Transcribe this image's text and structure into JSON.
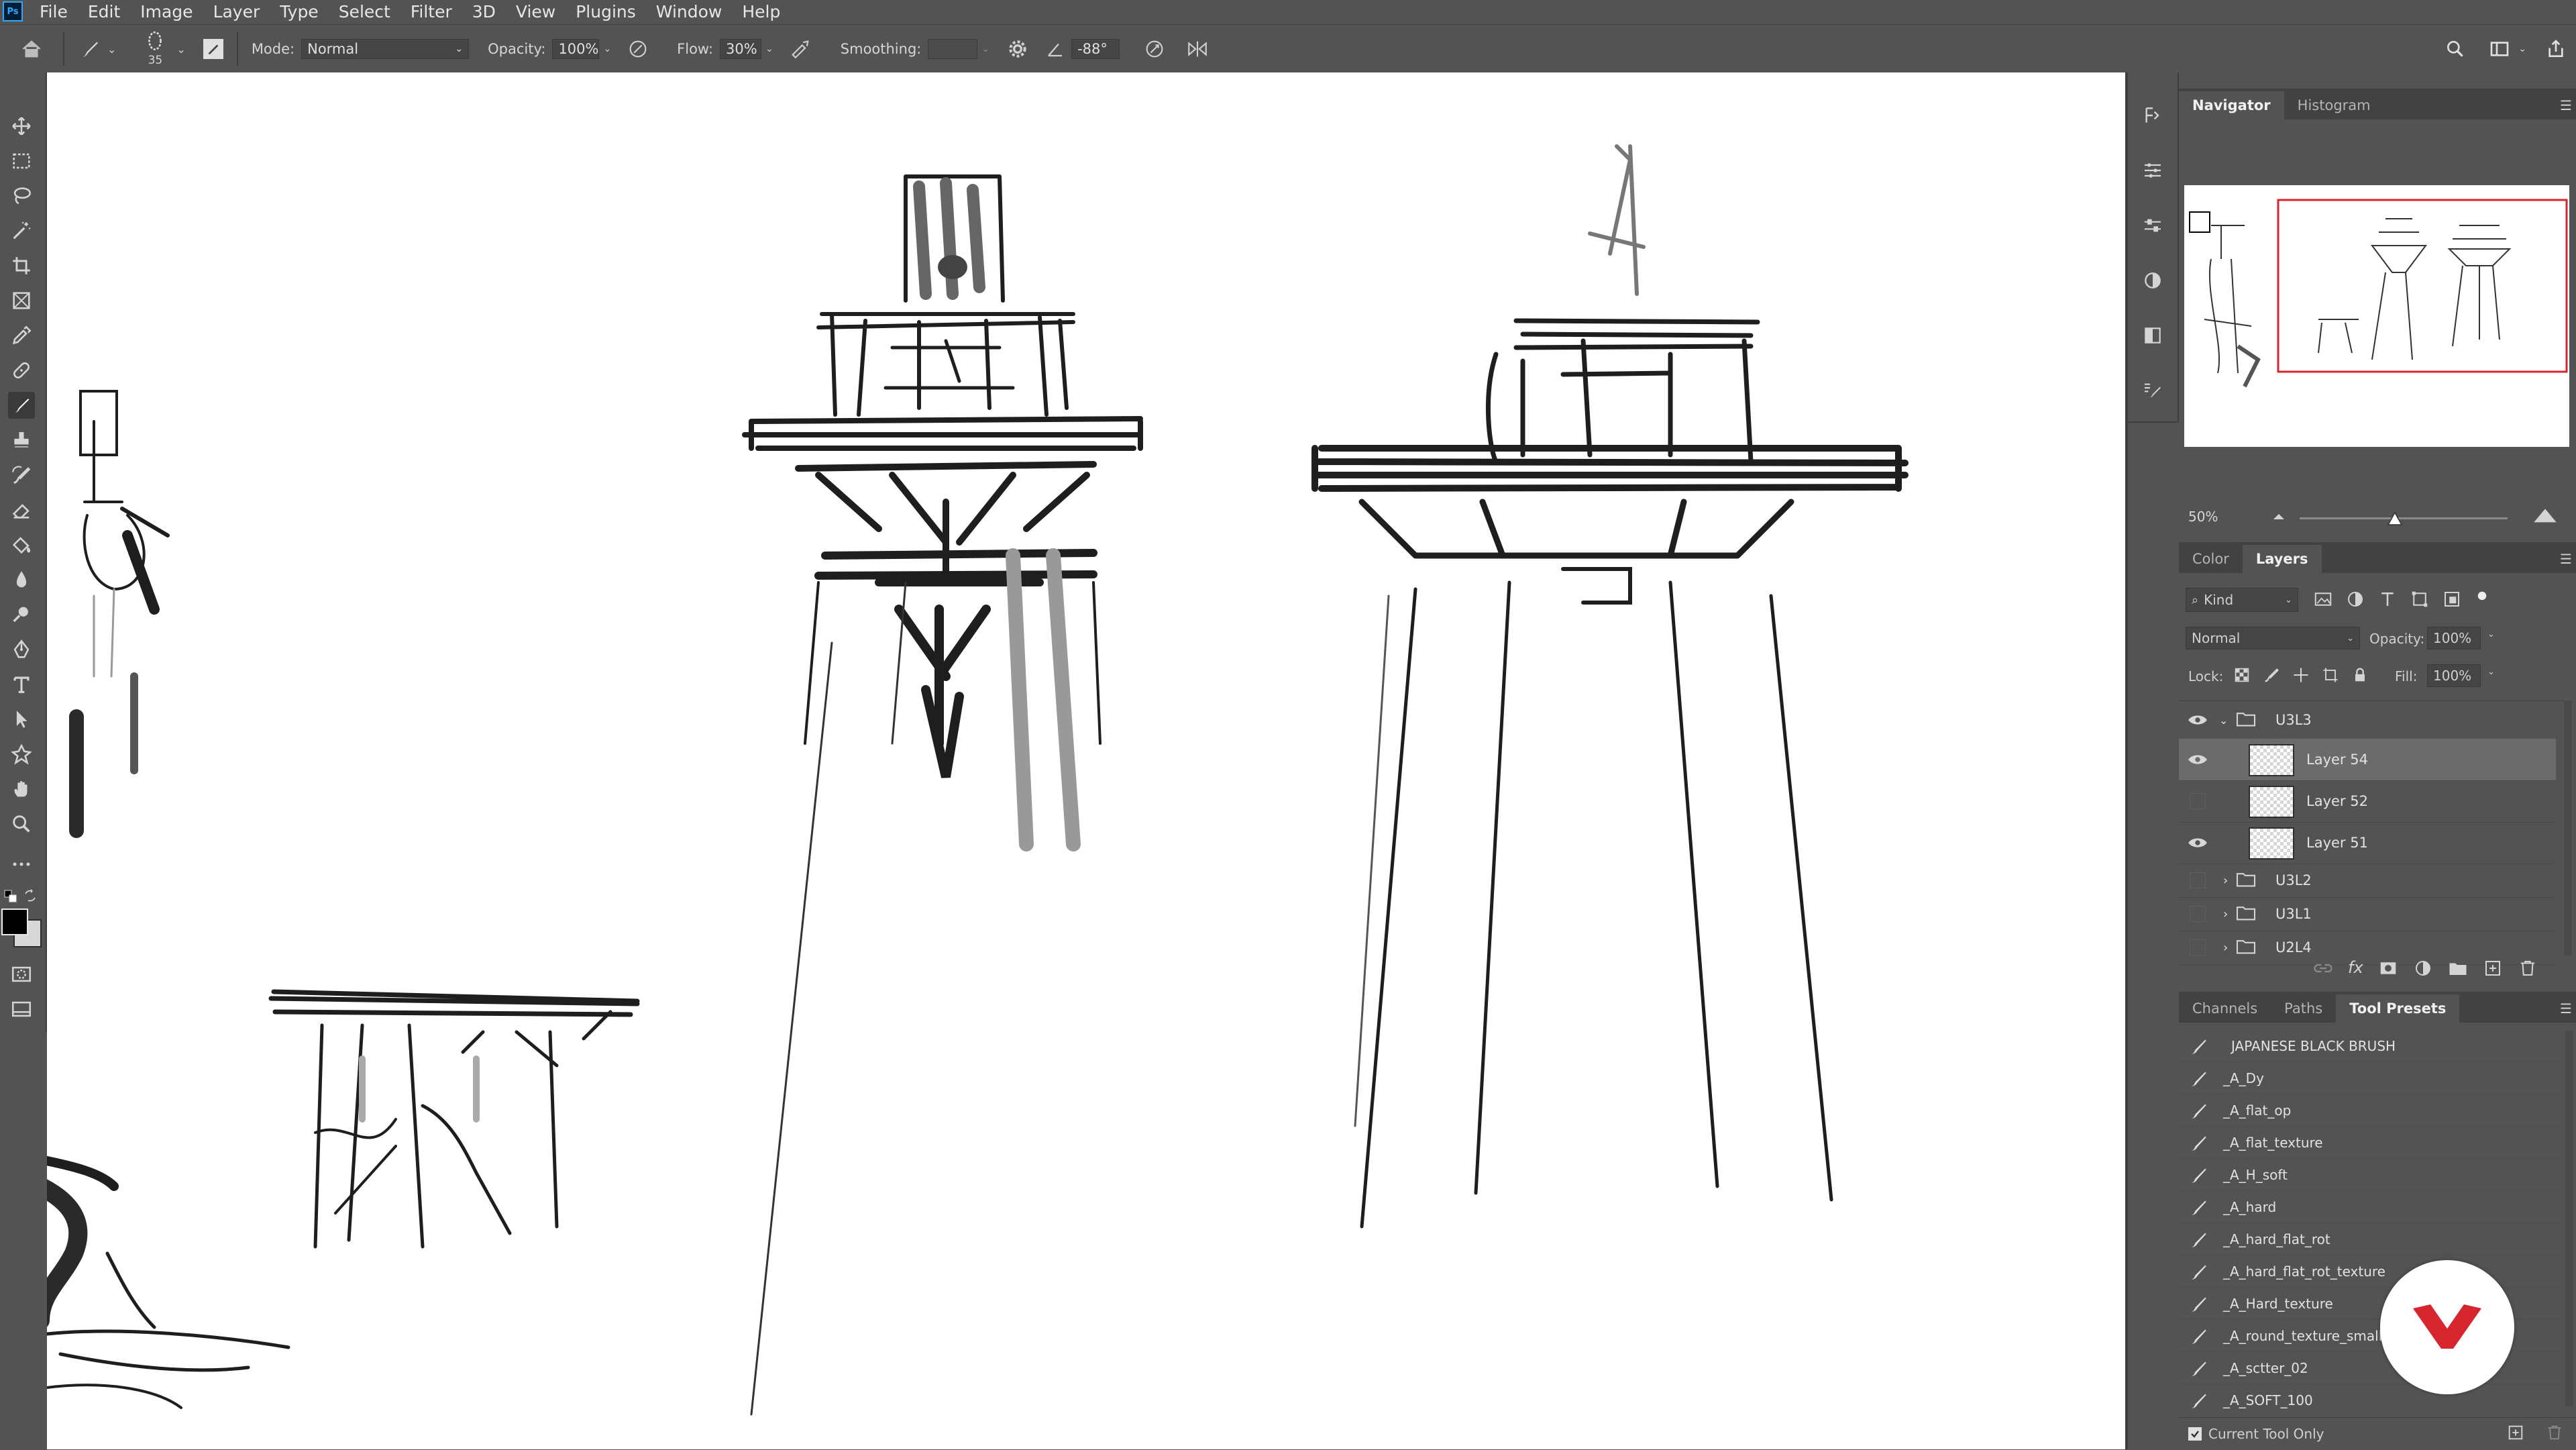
{
  "app": {
    "logo_text": "Ps",
    "menu": [
      "File",
      "Edit",
      "Image",
      "Layer",
      "Type",
      "Select",
      "Filter",
      "3D",
      "View",
      "Plugins",
      "Window",
      "Help"
    ]
  },
  "options": {
    "brush_size": "35",
    "mode_label": "Mode:",
    "mode_value": "Normal",
    "opacity_label": "Opacity:",
    "opacity_value": "100%",
    "flow_label": "Flow:",
    "flow_value": "30%",
    "smoothing_label": "Smoothing:",
    "smoothing_value": "",
    "angle_value": "-88°"
  },
  "tools": [
    "move-icon",
    "marquee-icon",
    "lasso-icon",
    "magic-wand-icon",
    "crop-icon",
    "frame-icon",
    "eyedropper-icon",
    "healing-icon",
    "brush-icon",
    "stamp-icon",
    "history-brush-icon",
    "eraser-icon",
    "paint-bucket-icon",
    "blur-icon",
    "dodge-icon",
    "pen-icon",
    "type-icon",
    "path-select-icon",
    "shape-icon",
    "hand-icon",
    "zoom-icon",
    "more-icon"
  ],
  "colors": {
    "foreground": "#000000",
    "background": "#d8d8d8",
    "accent": "#d7262e",
    "panel": "#535353"
  },
  "navigator": {
    "tabs": [
      "Navigator",
      "Histogram"
    ],
    "active_tab": "Navigator",
    "zoom": "50%"
  },
  "layers": {
    "tabs": [
      "Color",
      "Layers"
    ],
    "active_tab": "Layers",
    "kind_label": "Kind",
    "blend_mode": "Normal",
    "opacity_label": "Opacity:",
    "opacity_value": "100%",
    "lock_label": "Lock:",
    "fill_label": "Fill:",
    "fill_value": "100%",
    "rows": [
      {
        "name": "U3L3",
        "type": "group",
        "expanded": true,
        "visible": true
      },
      {
        "name": "Layer 54",
        "type": "layer",
        "visible": true,
        "selected": true
      },
      {
        "name": "Layer 52",
        "type": "layer",
        "visible": false
      },
      {
        "name": "Layer 51",
        "type": "layer",
        "visible": true
      },
      {
        "name": "U3L2",
        "type": "group",
        "expanded": false,
        "visible": false
      },
      {
        "name": "U3L1",
        "type": "group",
        "expanded": false,
        "visible": false
      },
      {
        "name": "U2L4",
        "type": "group",
        "expanded": false,
        "visible": false
      }
    ]
  },
  "presets": {
    "tabs": [
      "Channels",
      "Paths",
      "Tool Presets"
    ],
    "active_tab": "Tool Presets",
    "items": [
      "JAPANESE BLACK BRUSH",
      "_A_Dy",
      "_A_flat_op",
      "_A_flat_texture",
      "_A_H_soft",
      "_A_hard",
      "_A_hard_flat_rot",
      "_A_hard_flat_rot_texture",
      "_A_Hard_texture",
      "_A_round_texture_small",
      "_A_sctter_02",
      "_A_SOFT_100"
    ],
    "current_tool_only": "Current Tool Only"
  }
}
